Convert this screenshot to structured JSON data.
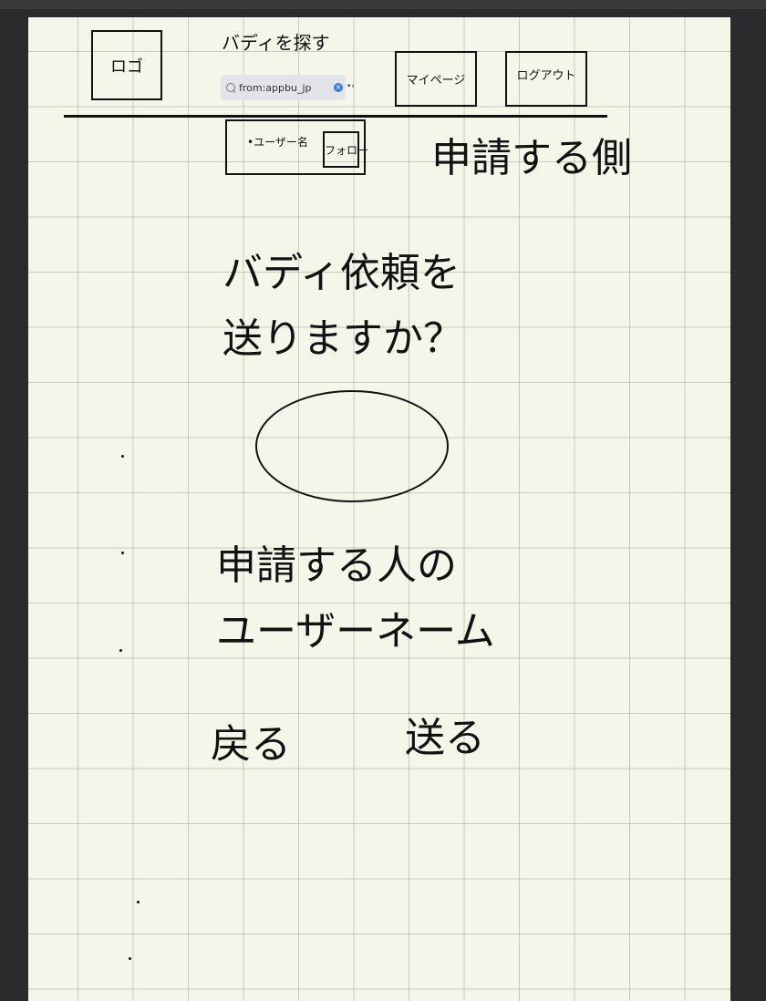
{
  "header": {
    "logo_label": "ロゴ",
    "search_title": "バディを探す",
    "search_value": "from:appbu_jp",
    "mypage_label": "マイページ",
    "logout_label": "ログアウト"
  },
  "user_card": {
    "username_label": "•ユーザー名",
    "follow_label": "フォロー"
  },
  "side_label": "申請する側",
  "dialog": {
    "question_line1": "バディ依頼を",
    "question_line2": "送りますか？",
    "applicant_line1": "申請する人の",
    "applicant_line2": "ユーザーネーム",
    "back_label": "戻る",
    "send_label": "送る"
  }
}
